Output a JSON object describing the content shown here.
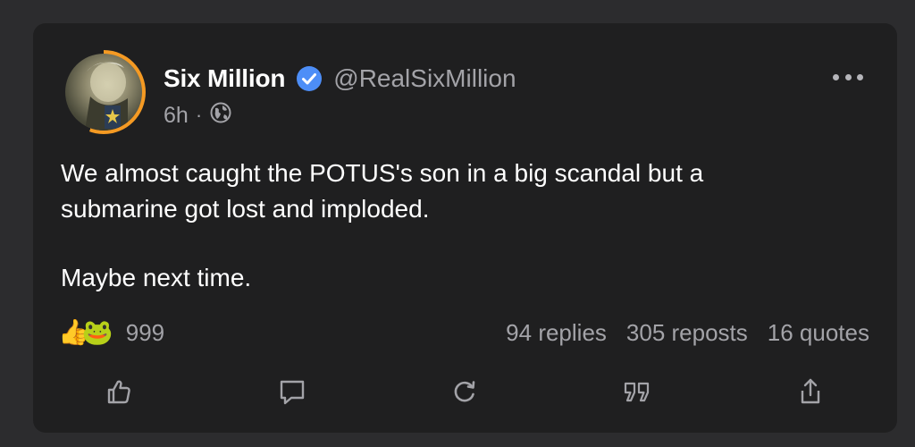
{
  "post": {
    "author_name": "Six Million",
    "handle": "@RealSixMillion",
    "time": "6h",
    "separator": "·",
    "visibility_icon": "globe-icon",
    "verified_icon": "verified-check-icon",
    "body_line_1": "We almost caught the POTUS's son in a big scandal but a",
    "body_line_2": "submarine got lost and imploded.",
    "body_line_3": "Maybe next time.",
    "reactions": {
      "emoji_1": "👍",
      "emoji_2": "🐸",
      "count": "999"
    },
    "stats": {
      "replies": "94 replies",
      "reposts": "305 reposts",
      "quotes": "16 quotes"
    },
    "actions": [
      "like-icon",
      "reply-icon",
      "repost-icon",
      "quote-icon",
      "share-icon"
    ]
  },
  "colors": {
    "background": "#2c2c2e",
    "card": "#1f1f20",
    "text_primary": "#ffffff",
    "text_secondary": "#a3a3a8",
    "verified_blue": "#4d8ef7",
    "avatar_ring": "#f59a23"
  }
}
